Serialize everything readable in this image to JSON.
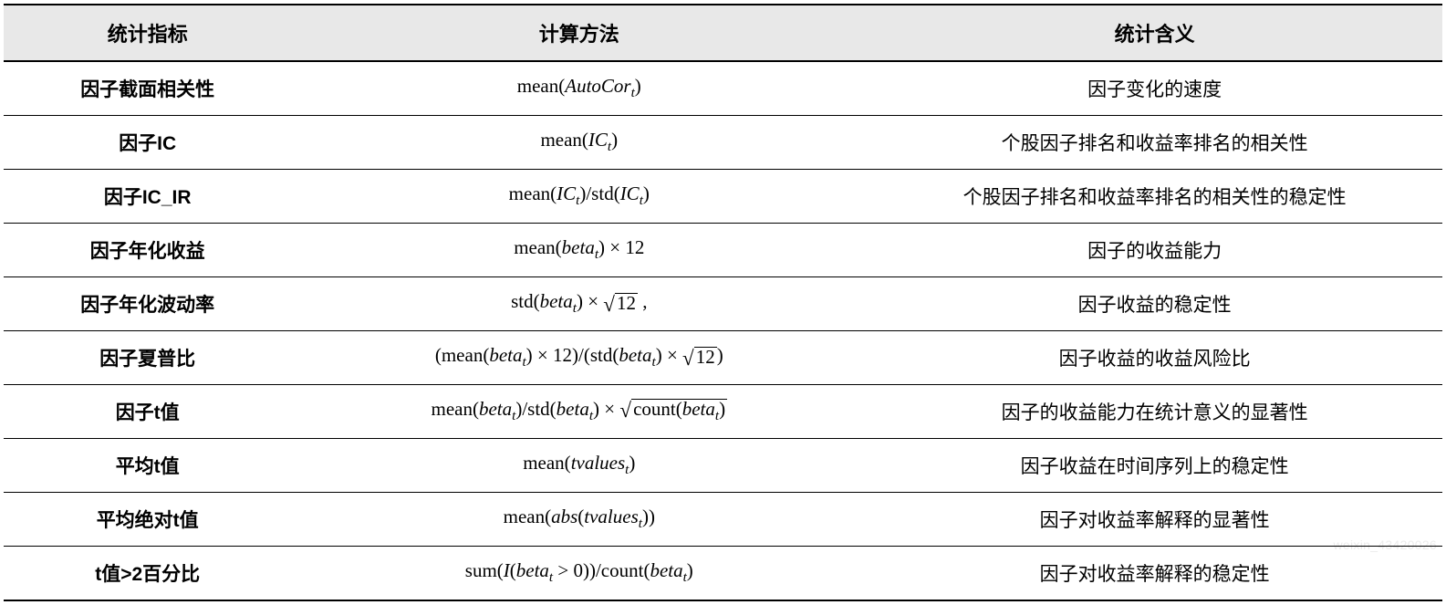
{
  "table": {
    "headers": {
      "indicator": "统计指标",
      "method": "计算方法",
      "meaning": "统计含义"
    },
    "rows": [
      {
        "indicator": "因子截面相关性",
        "formula_slot": "f0",
        "meaning": "因子变化的速度"
      },
      {
        "indicator": "因子IC",
        "formula_slot": "f1",
        "meaning": "个股因子排名和收益率排名的相关性"
      },
      {
        "indicator": "因子IC_IR",
        "formula_slot": "f2",
        "meaning": "个股因子排名和收益率排名的相关性的稳定性"
      },
      {
        "indicator": "因子年化收益",
        "formula_slot": "f3",
        "meaning": "因子的收益能力"
      },
      {
        "indicator": "因子年化波动率",
        "formula_slot": "f4",
        "meaning": "因子收益的稳定性"
      },
      {
        "indicator": "因子夏普比",
        "formula_slot": "f5",
        "meaning": "因子收益的收益风险比"
      },
      {
        "indicator": "因子t值",
        "formula_slot": "f6",
        "meaning": "因子的收益能力在统计意义的显著性"
      },
      {
        "indicator": "平均t值",
        "formula_slot": "f7",
        "meaning": "因子收益在时间序列上的稳定性"
      },
      {
        "indicator": "平均绝对t值",
        "formula_slot": "f8",
        "meaning": "因子对收益率解释的显著性"
      },
      {
        "indicator": "t值>2百分比",
        "formula_slot": "f9",
        "meaning": "因子对收益率解释的稳定性"
      }
    ]
  },
  "chart_data": {
    "type": "table",
    "columns": [
      "统计指标",
      "计算方法",
      "统计含义"
    ],
    "rows": [
      [
        "因子截面相关性",
        "mean(AutoCor_t)",
        "因子变化的速度"
      ],
      [
        "因子IC",
        "mean(IC_t)",
        "个股因子排名和收益率排名的相关性"
      ],
      [
        "因子IC_IR",
        "mean(IC_t)/std(IC_t)",
        "个股因子排名和收益率排名的相关性的稳定性"
      ],
      [
        "因子年化收益",
        "mean(beta_t) × 12",
        "因子的收益能力"
      ],
      [
        "因子年化波动率",
        "std(beta_t) × √12 ,",
        "因子收益的稳定性"
      ],
      [
        "因子夏普比",
        "(mean(beta_t) × 12)/(std(beta_t) × √12)",
        "因子收益的收益风险比"
      ],
      [
        "因子t值",
        "mean(beta_t)/std(beta_t) × √count(beta_t)",
        "因子的收益能力在统计意义的显著性"
      ],
      [
        "平均t值",
        "mean(tvalues_t)",
        "因子收益在时间序列上的稳定性"
      ],
      [
        "平均绝对t值",
        "mean(abs(tvalues_t))",
        "因子对收益率解释的显著性"
      ],
      [
        "t值>2百分比",
        "sum(I(beta_t > 0))/count(beta_t)",
        "因子对收益率解释的稳定性"
      ]
    ]
  },
  "watermark": "weixin_43420026"
}
